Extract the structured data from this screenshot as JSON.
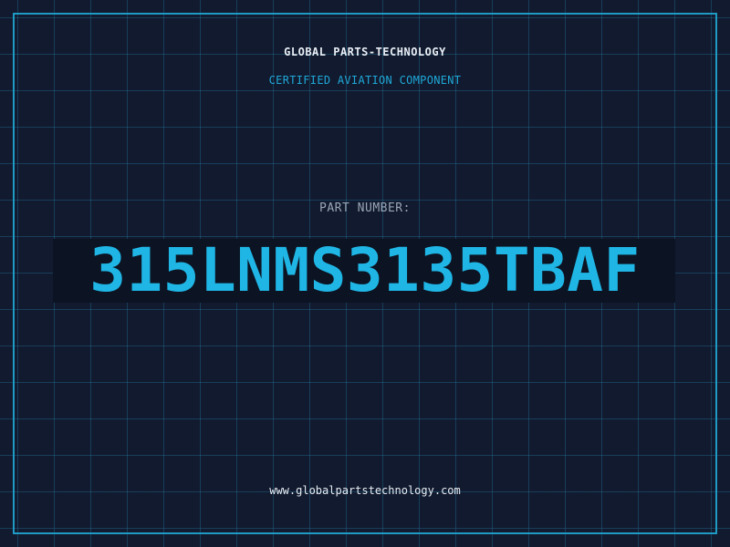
{
  "header": {
    "company": "GLOBAL PARTS-TECHNOLOGY",
    "certification": "CERTIFIED AVIATION COMPONENT"
  },
  "part": {
    "label": "PART NUMBER:",
    "number": "315LNMS3135TBAF"
  },
  "footer": {
    "website": "www.globalpartstechnology.com"
  },
  "colors": {
    "background": "#111a2e",
    "grid": "#2478a0",
    "accent": "#1fb6e6",
    "text": "#e8eef5",
    "muted": "#9aa6b6"
  }
}
